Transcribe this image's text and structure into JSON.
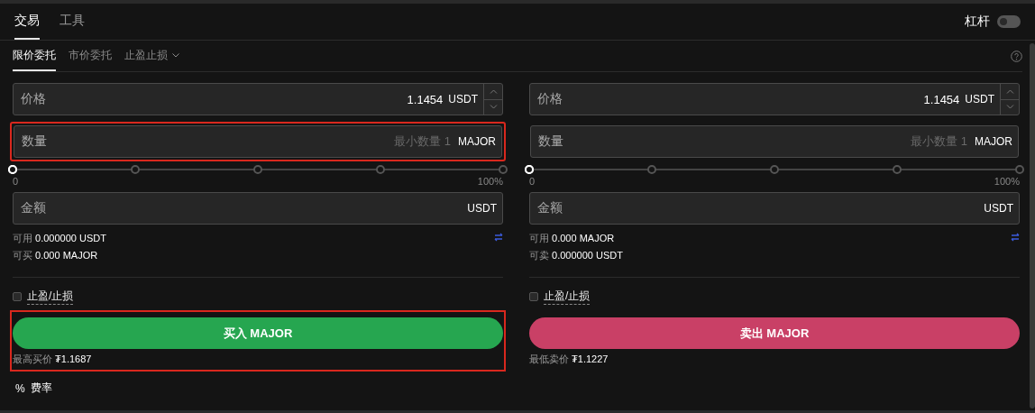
{
  "tabs": [
    {
      "label": "交易",
      "selected": true
    },
    {
      "label": "工具",
      "selected": false
    }
  ],
  "leverage": {
    "label": "杠杆",
    "on": false
  },
  "order_types": [
    {
      "label": "限价委托",
      "selected": true,
      "dropdown": false
    },
    {
      "label": "市价委托",
      "selected": false,
      "dropdown": false
    },
    {
      "label": "止盈止损",
      "selected": false,
      "dropdown": true
    }
  ],
  "panels": [
    {
      "kind": "buy",
      "price": {
        "label": "价格",
        "value": "1.1454",
        "unit": "USDT"
      },
      "quantity": {
        "label": "数量",
        "placeholder": "最小数量 1",
        "unit": "MAJOR",
        "highlighted": true
      },
      "slider": {
        "level": 0,
        "min_label": "0",
        "max_label": "100%"
      },
      "amount": {
        "label": "金额",
        "unit": "USDT"
      },
      "balances": [
        {
          "label": "可用",
          "value": "0.000000 USDT"
        },
        {
          "label": "可买",
          "value": "0.000 MAJOR"
        }
      ],
      "tpsl": {
        "label": "止盈/止损",
        "checked": false
      },
      "button": {
        "label": "买入 MAJOR",
        "highlighted": true
      },
      "best_price": {
        "label": "最高买价",
        "value": "₮1.1687"
      }
    },
    {
      "kind": "sell",
      "price": {
        "label": "价格",
        "value": "1.1454",
        "unit": "USDT"
      },
      "quantity": {
        "label": "数量",
        "placeholder": "最小数量 1",
        "unit": "MAJOR",
        "highlighted": false
      },
      "slider": {
        "level": 0,
        "min_label": "0",
        "max_label": "100%"
      },
      "amount": {
        "label": "金额",
        "unit": "USDT"
      },
      "balances": [
        {
          "label": "可用",
          "value": "0.000 MAJOR"
        },
        {
          "label": "可卖",
          "value": "0.000000 USDT"
        }
      ],
      "tpsl": {
        "label": "止盈/止损",
        "checked": false
      },
      "button": {
        "label": "卖出 MAJOR",
        "highlighted": false
      },
      "best_price": {
        "label": "最低卖价",
        "value": "₮1.1227"
      }
    }
  ],
  "fee": {
    "icon": "%",
    "label": "费率"
  }
}
